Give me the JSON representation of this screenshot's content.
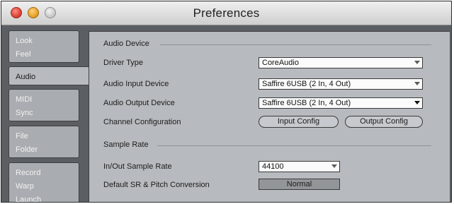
{
  "window": {
    "title": "Preferences"
  },
  "sidebar": {
    "tabs": [
      {
        "lines": [
          "Look",
          "Feel"
        ]
      },
      {
        "lines": [
          "Audio"
        ]
      },
      {
        "lines": [
          "MIDI",
          "Sync"
        ]
      },
      {
        "lines": [
          "File",
          "Folder"
        ]
      },
      {
        "lines": [
          "Record",
          "Warp",
          "Launch"
        ]
      }
    ],
    "active": "Audio"
  },
  "audio_device": {
    "section_title": "Audio Device",
    "driver_type": {
      "label": "Driver Type",
      "value": "CoreAudio",
      "icon": "chevron-down-icon"
    },
    "input_device": {
      "label": "Audio Input Device",
      "value": "Saffire 6USB (2 In, 4 Out)",
      "icon": "chevron-down-icon"
    },
    "output_device": {
      "label": "Audio Output Device",
      "value": "Saffire 6USB (2 In, 4 Out)",
      "icon": "chevron-down-icon"
    },
    "channel_config": {
      "label": "Channel Configuration",
      "input_button": "Input Config",
      "output_button": "Output Config"
    }
  },
  "sample_rate": {
    "section_title": "Sample Rate",
    "io_rate": {
      "label": "In/Out Sample Rate",
      "value": "44100",
      "icon": "chevron-down-icon"
    },
    "conversion": {
      "label": "Default SR & Pitch Conversion",
      "value": "Normal"
    }
  },
  "colors": {
    "panel": "#b7babe",
    "sidebar": "#5b5e62",
    "tab": "#a9acb0",
    "field": "#fbfbfb"
  }
}
